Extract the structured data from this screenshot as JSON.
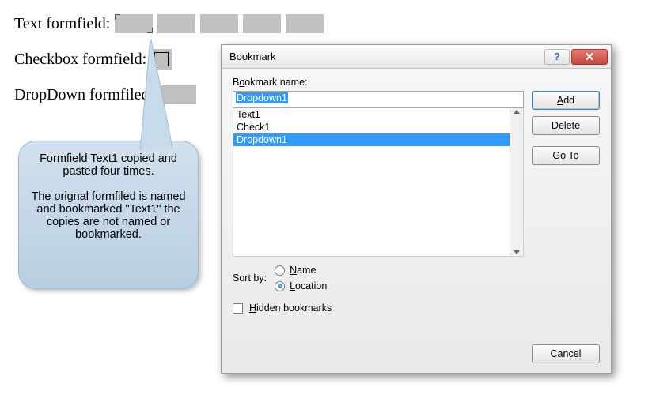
{
  "doc": {
    "row1_label": "Text formfield:",
    "row2_label": "Checkbox formfield:",
    "row3_label": "DropDown formfiled:"
  },
  "callout": {
    "p1": "Formfield Text1 copied and pasted four times.",
    "p2": "The orignal formfiled is named and bookmarked \"Text1\"  the copies are not named or bookmarked."
  },
  "dialog": {
    "title": "Bookmark",
    "name_label_pre": "B",
    "name_label_u": "o",
    "name_label_post": "okmark name:",
    "input_value": "Dropdown1",
    "list": [
      {
        "text": "Text1",
        "selected": false
      },
      {
        "text": "Check1",
        "selected": false
      },
      {
        "text": "Dropdown1",
        "selected": true
      }
    ],
    "btn_add": "Add",
    "btn_delete": "Delete",
    "btn_goto": "Go To",
    "sort_label": "Sort by:",
    "sort_name_u": "N",
    "sort_name_post": "ame",
    "sort_loc_u": "L",
    "sort_loc_post": "ocation",
    "hidden_u": "H",
    "hidden_post": "idden bookmarks",
    "btn_cancel": "Cancel"
  }
}
